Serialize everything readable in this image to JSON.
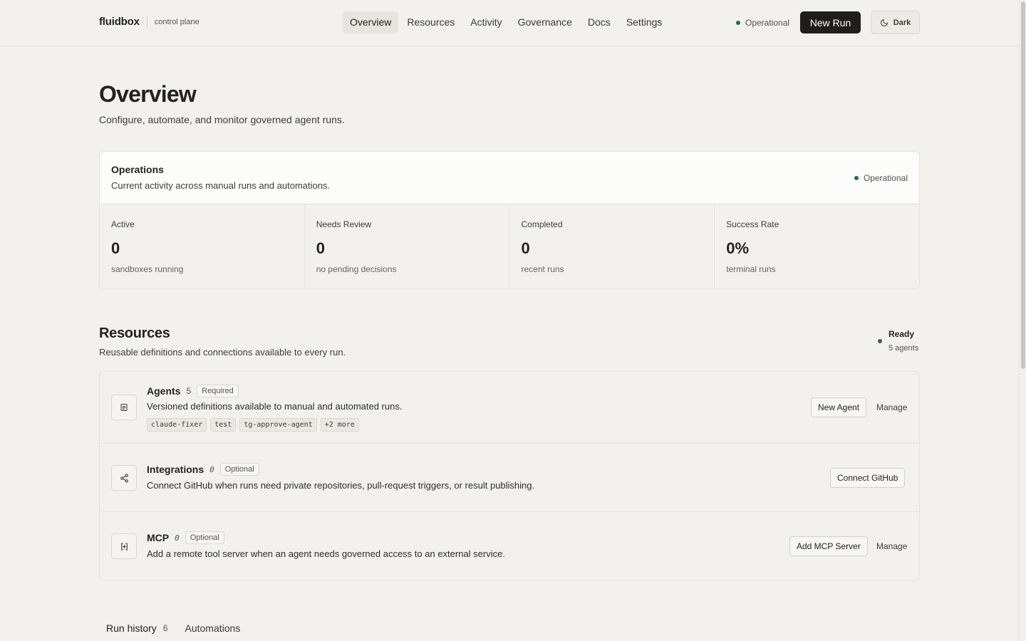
{
  "header": {
    "brand": "fluidbox",
    "subtitle": "control plane",
    "nav": [
      {
        "label": "Overview",
        "active": true
      },
      {
        "label": "Resources",
        "active": false
      },
      {
        "label": "Activity",
        "active": false
      },
      {
        "label": "Governance",
        "active": false
      },
      {
        "label": "Docs",
        "active": false
      },
      {
        "label": "Settings",
        "active": false
      }
    ],
    "status": "Operational",
    "new_run": "New Run",
    "theme": "Dark"
  },
  "page": {
    "title": "Overview",
    "subtitle": "Configure, automate, and monitor governed agent runs."
  },
  "operations": {
    "title": "Operations",
    "description": "Current activity across manual runs and automations.",
    "status": "Operational",
    "stats": [
      {
        "label": "Active",
        "value": "0",
        "sub": "sandboxes running"
      },
      {
        "label": "Needs Review",
        "value": "0",
        "sub": "no pending decisions"
      },
      {
        "label": "Completed",
        "value": "0",
        "sub": "recent runs"
      },
      {
        "label": "Success Rate",
        "value": "0%",
        "sub": "terminal runs"
      }
    ]
  },
  "resources": {
    "title": "Resources",
    "subtitle": "Reusable definitions and connections available to every run.",
    "ready": "Ready",
    "ready_count": "5 agents",
    "agents": {
      "name": "Agents",
      "count": "5",
      "badge": "Required",
      "description": "Versioned definitions available to manual and automated runs.",
      "chips": [
        "claude-fixer",
        "test",
        "tg-approve-agent",
        "+2 more"
      ],
      "primary": "New Agent",
      "secondary": "Manage"
    },
    "integrations": {
      "name": "Integrations",
      "count": "0",
      "badge": "Optional",
      "description": "Connect GitHub when runs need private repositories, pull-request triggers, or result publishing.",
      "primary": "Connect GitHub"
    },
    "mcp": {
      "name": "MCP",
      "count": "0",
      "badge": "Optional",
      "description": "Add a remote tool server when an agent needs governed access to an external service.",
      "primary": "Add MCP Server",
      "secondary": "Manage"
    }
  },
  "tabs": [
    {
      "label": "Run history",
      "count": "6"
    },
    {
      "label": "Automations"
    }
  ],
  "colors": {
    "background": "#f2f1ed",
    "accent_dark": "#1f1e1c",
    "status_green": "#2a6a47"
  }
}
